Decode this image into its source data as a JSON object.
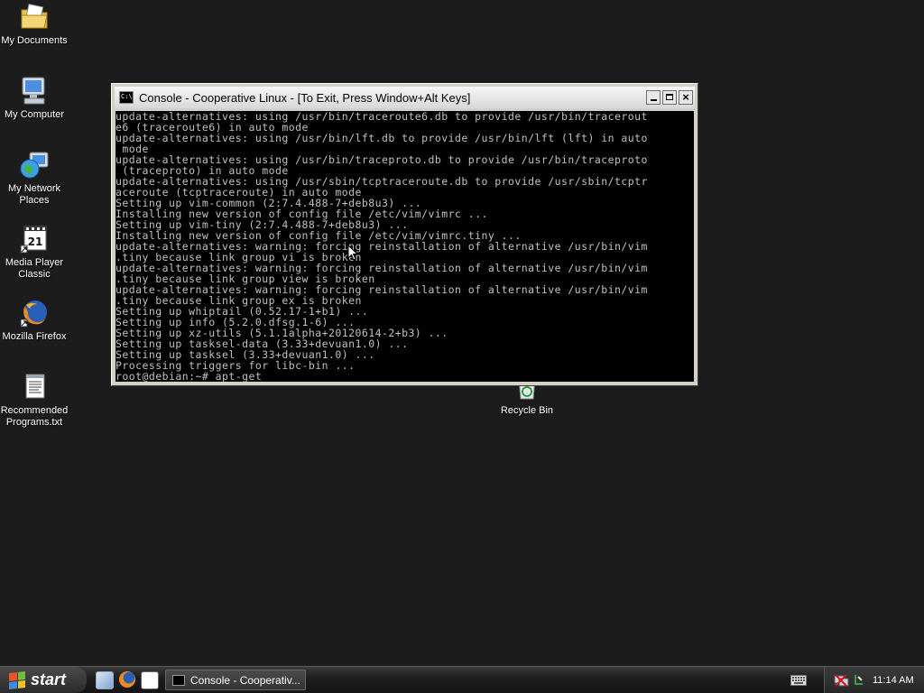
{
  "desktop": {
    "icons": [
      {
        "label": "My Documents"
      },
      {
        "label": "My Computer"
      },
      {
        "label": "My Network Places"
      },
      {
        "label": "Media Player Classic"
      },
      {
        "label": "Mozilla Firefox"
      },
      {
        "label": "Recommended Programs.txt"
      },
      {
        "label": "Recycle Bin"
      }
    ]
  },
  "console": {
    "title": "Console - Cooperative Linux - [To Exit, Press Window+Alt Keys]",
    "icon_text": "C:\\",
    "lines": [
      "update-alternatives: using /usr/bin/traceroute6.db to provide /usr/bin/tracerout",
      "e6 (traceroute6) in auto mode",
      "update-alternatives: using /usr/bin/lft.db to provide /usr/bin/lft (lft) in auto",
      " mode",
      "update-alternatives: using /usr/bin/traceproto.db to provide /usr/bin/traceproto",
      " (traceproto) in auto mode",
      "update-alternatives: using /usr/sbin/tcptraceroute.db to provide /usr/sbin/tcptr",
      "aceroute (tcptraceroute) in auto mode",
      "Setting up vim-common (2:7.4.488-7+deb8u3) ...",
      "Installing new version of config file /etc/vim/vimrc ...",
      "Setting up vim-tiny (2:7.4.488-7+deb8u3) ...",
      "Installing new version of config file /etc/vim/vimrc.tiny ...",
      "update-alternatives: warning: forcing reinstallation of alternative /usr/bin/vim",
      ".tiny because link group vi is broken",
      "update-alternatives: warning: forcing reinstallation of alternative /usr/bin/vim",
      ".tiny because link group view is broken",
      "update-alternatives: warning: forcing reinstallation of alternative /usr/bin/vim",
      ".tiny because link group ex is broken",
      "Setting up whiptail (0.52.17-1+b1) ...",
      "Setting up info (5.2.0.dfsg.1-6) ...",
      "Setting up xz-utils (5.1.1alpha+20120614-2+b3) ...",
      "Setting up tasksel-data (3.33+devuan1.0) ...",
      "Setting up tasksel (3.33+devuan1.0) ...",
      "Processing triggers for libc-bin ...",
      "root@debian:~# apt-get_"
    ]
  },
  "taskbar": {
    "start_label": "start",
    "task_console_label": "Console - Cooperativ...",
    "clock": "11:14 AM"
  }
}
